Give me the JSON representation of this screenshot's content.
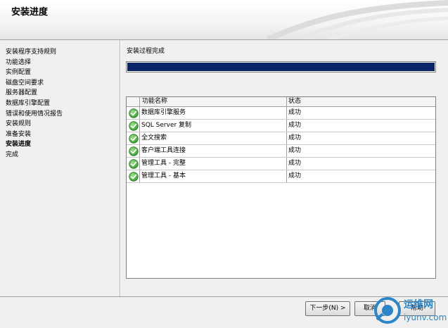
{
  "header": {
    "title": "安装进度"
  },
  "nav": {
    "items": [
      {
        "label": "安装程序支持规则"
      },
      {
        "label": "功能选择"
      },
      {
        "label": "实例配置"
      },
      {
        "label": "磁盘空间要求"
      },
      {
        "label": "服务器配置"
      },
      {
        "label": "数据库引擎配置"
      },
      {
        "label": "错误和使用情况报告"
      },
      {
        "label": "安装规则"
      },
      {
        "label": "准备安装"
      },
      {
        "label": "安装进度"
      },
      {
        "label": "完成"
      }
    ],
    "active_index": 9
  },
  "main": {
    "status": "安装过程完成",
    "progress": 1.0,
    "progress_color": "#0a246a",
    "table": {
      "headers": [
        "功能名称",
        "状态"
      ],
      "rows": [
        {
          "name": "数据库引擎服务",
          "status": "成功",
          "icon": "check-circle-icon"
        },
        {
          "name": "SQL Server 复制",
          "status": "成功",
          "icon": "check-circle-icon"
        },
        {
          "name": "全文搜索",
          "status": "成功",
          "icon": "check-circle-icon"
        },
        {
          "name": "客户端工具连接",
          "status": "成功",
          "icon": "check-circle-icon"
        },
        {
          "name": "管理工具 - 完整",
          "status": "成功",
          "icon": "check-circle-icon"
        },
        {
          "name": "管理工具 - 基本",
          "status": "成功",
          "icon": "check-circle-icon"
        }
      ]
    }
  },
  "buttons": {
    "next": "下一步(N) >",
    "cancel": "取消",
    "help": "帮助"
  },
  "watermark": {
    "cn": "运维网",
    "en": "iyunv.com",
    "color": "#2a86c8"
  }
}
